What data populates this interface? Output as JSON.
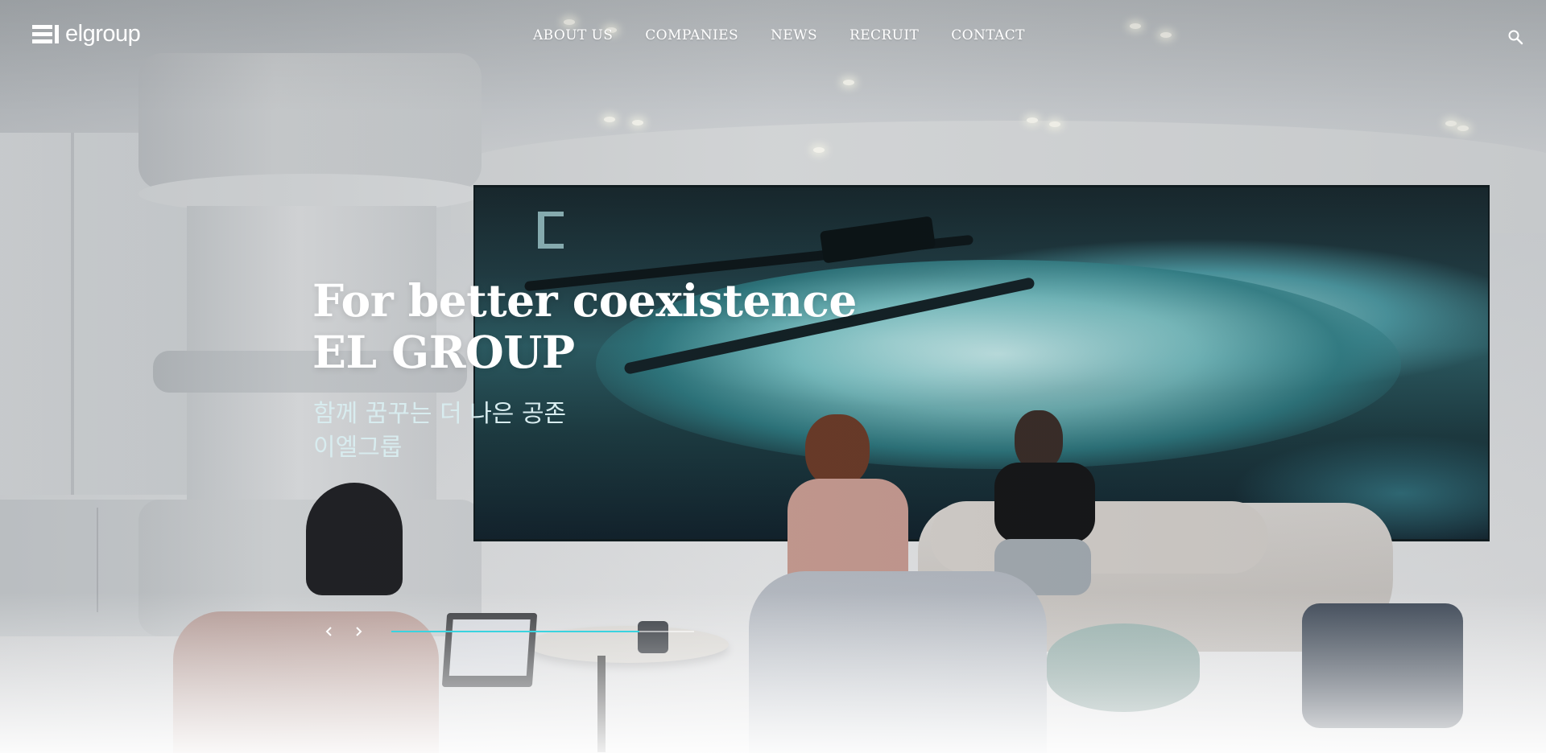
{
  "brand": {
    "name": "elgroup"
  },
  "nav": {
    "items": [
      {
        "label": "ABOUT US"
      },
      {
        "label": "COMPANIES"
      },
      {
        "label": "NEWS"
      },
      {
        "label": "RECRUIT"
      },
      {
        "label": "CONTACT"
      }
    ]
  },
  "header": {
    "search_icon": "search-icon"
  },
  "hero": {
    "title_line1": "For better coexistence",
    "title_line2": "EL GROUP",
    "subtitle_line1": "함께 꿈꾸는 더 나은 공존",
    "subtitle_line2": "이엘그룹"
  },
  "slider": {
    "prev_icon": "chevron-left-icon",
    "next_icon": "chevron-right-icon",
    "progress": 0.82,
    "accent_color": "#3ad3df"
  },
  "colors": {
    "nav_text": "#ffffff",
    "subtitle_text": "#d8ecef"
  }
}
